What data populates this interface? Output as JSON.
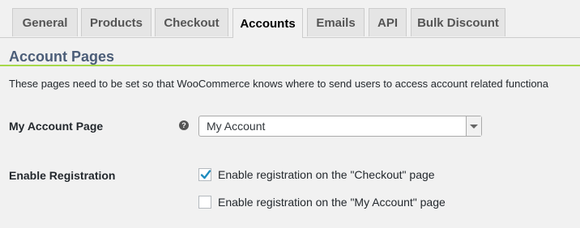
{
  "tabs": [
    {
      "label": "General",
      "active": false
    },
    {
      "label": "Products",
      "active": false
    },
    {
      "label": "Checkout",
      "active": false
    },
    {
      "label": "Accounts",
      "active": true
    },
    {
      "label": "Emails",
      "active": false
    },
    {
      "label": "API",
      "active": false
    },
    {
      "label": "Bulk Discount",
      "active": false
    }
  ],
  "section": {
    "title": "Account Pages",
    "description": "These pages need to be set so that WooCommerce knows where to send users to access account related functiona"
  },
  "my_account_page": {
    "label": "My Account Page",
    "help_icon": "question-circle-icon",
    "selected": "My Account"
  },
  "enable_registration": {
    "label": "Enable Registration",
    "options": [
      {
        "label": "Enable registration on the \"Checkout\" page",
        "checked": true
      },
      {
        "label": "Enable registration on the \"My Account\" page",
        "checked": false
      }
    ]
  },
  "colors": {
    "accent_rule": "#a6d84a",
    "title": "#4b5d78",
    "check": "#1e8cbe"
  }
}
